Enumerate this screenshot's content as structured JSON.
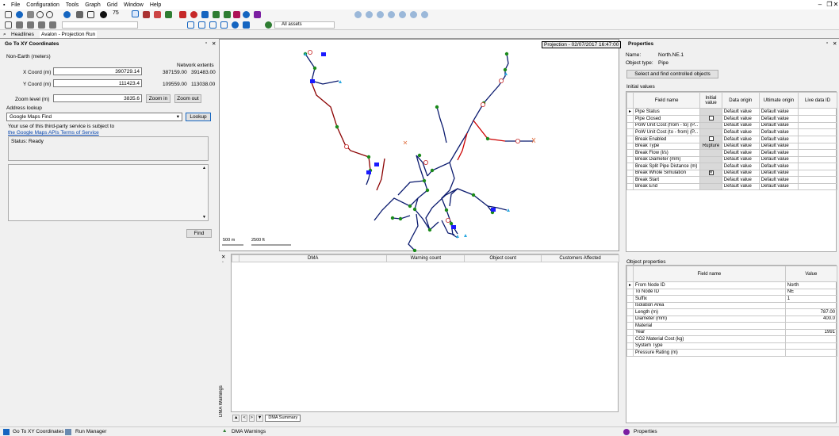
{
  "menu": [
    "File",
    "Configuration",
    "Tools",
    "Graph",
    "Grid",
    "Window",
    "Help"
  ],
  "toolbar": {
    "zoom_text": "75",
    "assets_select": "All assets"
  },
  "tabs": {
    "headlines": "Headlines",
    "avalon": "Avalon - Projection Run"
  },
  "goto": {
    "title": "Go To XY Coordinates",
    "crs": "Non-Earth (meters)",
    "network_extents": "Network extents",
    "x_label": "X Coord (m)",
    "x_value": "390729.14",
    "x_min": "387159.00",
    "x_max": "391483.00",
    "y_label": "Y Coord (m)",
    "y_value": "111423.4",
    "y_min": "109559.00",
    "y_max": "113038.00",
    "zoom_label": "Zoom level (m)",
    "zoom_value": "3835.6",
    "zoom_in": "Zoom in",
    "zoom_out": "Zoom out",
    "address_lookup": "Address lookup",
    "provider": "Google Maps Find",
    "lookup_btn": "Lookup",
    "terms_text": "Your use of this third-party service is subject to",
    "terms_link": "the Google Maps APIs Terms of Service",
    "status": "Status: Ready",
    "find_btn": "Find"
  },
  "map": {
    "projection_label": "Projection - 02/07/2017 16:47:00",
    "scale1": "500 m",
    "scale2": "2500 ft"
  },
  "dma": {
    "side_label": "DMA Warnings",
    "cols": [
      "DMA",
      "Warning count",
      "Object count",
      "Customers Affected"
    ],
    "summary_tab": "DMA Summary"
  },
  "properties": {
    "title": "Properties",
    "name_label": "Name:",
    "name_value": "North.NE.1",
    "type_label": "Object type:",
    "type_value": "Pipe",
    "select_btn": "Select and find controlled objects",
    "initial_values": "Initial values",
    "iv_cols": [
      "Field name",
      "Initial value",
      "Data origin",
      "Ultimate origin",
      "Live data ID"
    ],
    "iv_rows": [
      {
        "f": "Pipe Status",
        "v": "",
        "o": "Default value",
        "u": "Default value",
        "chk": ""
      },
      {
        "f": "Pipe Closed",
        "v": "",
        "o": "Default value",
        "u": "Default value",
        "chk": "box"
      },
      {
        "f": "PoW Unit Cost (from - to) (P...",
        "v": "",
        "o": "Default value",
        "u": "Default value",
        "chk": ""
      },
      {
        "f": "PoW Unit Cost (to - from) (P...",
        "v": "",
        "o": "Default value",
        "u": "Default value",
        "chk": ""
      },
      {
        "f": "Break Enabled",
        "v": "",
        "o": "Default value",
        "u": "Default value",
        "chk": "box"
      },
      {
        "f": "Break Type",
        "v": "Rupture",
        "o": "Default value",
        "u": "Default value",
        "chk": ""
      },
      {
        "f": "Break Flow (l/s)",
        "v": "",
        "o": "Default value",
        "u": "Default value",
        "chk": ""
      },
      {
        "f": "Break Diameter (mm)",
        "v": "",
        "o": "Default value",
        "u": "Default value",
        "chk": ""
      },
      {
        "f": "Break Split Pipe Distance (m)",
        "v": "",
        "o": "Default value",
        "u": "Default value",
        "chk": ""
      },
      {
        "f": "Break Whole Simulation",
        "v": "",
        "o": "Default value",
        "u": "Default value",
        "chk": "x"
      },
      {
        "f": "Break Start",
        "v": "",
        "o": "Default value",
        "u": "Default value",
        "chk": ""
      },
      {
        "f": "Break End",
        "v": "",
        "o": "Default value",
        "u": "Default value",
        "chk": ""
      }
    ],
    "object_properties": "Object properties",
    "op_cols": [
      "Field name",
      "Value"
    ],
    "op_rows": [
      {
        "f": "From Node ID",
        "v": "North",
        "a": "left"
      },
      {
        "f": "To Node ID",
        "v": "NE",
        "a": "left"
      },
      {
        "f": "Suffix",
        "v": "1",
        "a": "left"
      },
      {
        "f": "Isolation Area",
        "v": "",
        "a": "left"
      },
      {
        "f": "Length (m)",
        "v": "787.00",
        "a": "right"
      },
      {
        "f": "Diameter (mm)",
        "v": "400.0",
        "a": "right"
      },
      {
        "f": "Material",
        "v": "",
        "a": "left"
      },
      {
        "f": "Year",
        "v": "1991",
        "a": "right"
      },
      {
        "f": "CO2 Material Cost (kg)",
        "v": "",
        "a": "left"
      },
      {
        "f": "System Type",
        "v": "",
        "a": "left"
      },
      {
        "f": "Pressure Rating (m)",
        "v": "",
        "a": "left"
      }
    ]
  },
  "statusbar": {
    "goto": "Go To XY Coordinates",
    "run_manager": "Run Manager",
    "dma_warnings": "DMA Warnings",
    "properties": "Properties"
  }
}
